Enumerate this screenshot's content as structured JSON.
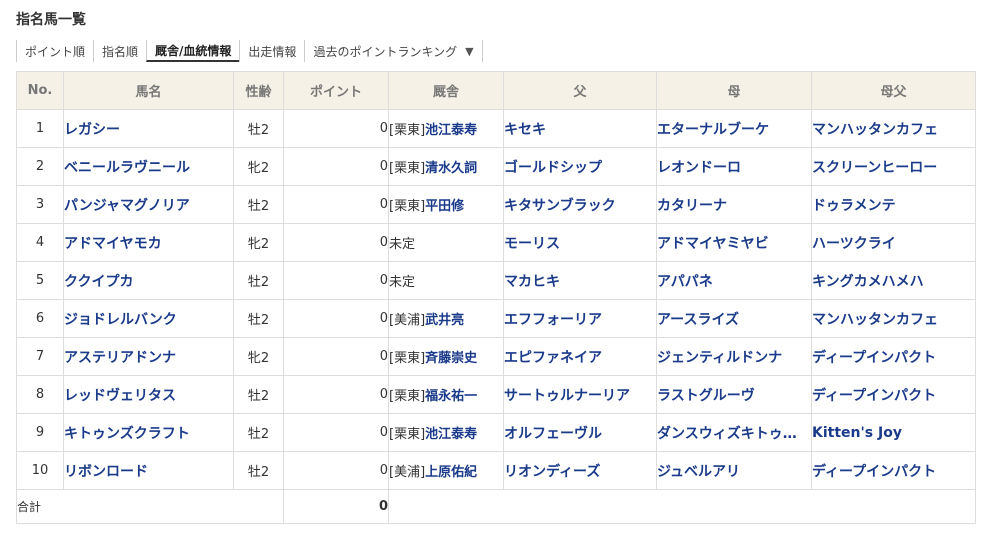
{
  "page": {
    "title": "指名馬一覧"
  },
  "tabs": [
    "ポイント順",
    "指名順",
    "厩舎/血統情報",
    "出走情報",
    "過去のポイントランキング"
  ],
  "active_tab": 2,
  "table": {
    "headers": [
      "No.",
      "馬名",
      "性齢",
      "ポイント",
      "厩舎",
      "父",
      "母",
      "母父"
    ],
    "rows": [
      {
        "no": "1",
        "name": "レガシー",
        "sex": "牡2",
        "points": "0",
        "region": "[栗東]",
        "trainer": "池江泰寿",
        "sire": "キセキ",
        "dam": "エターナルブーケ",
        "damsire": "マンハッタンカフェ"
      },
      {
        "no": "2",
        "name": "ベニールラヴニール",
        "sex": "牝2",
        "points": "0",
        "region": "[栗東]",
        "trainer": "清水久詞",
        "sire": "ゴールドシップ",
        "dam": "レオンドーロ",
        "damsire": "スクリーンヒーロー"
      },
      {
        "no": "3",
        "name": "パンジャマグノリア",
        "sex": "牡2",
        "points": "0",
        "region": "[栗東]",
        "trainer": "平田修",
        "sire": "キタサンブラック",
        "dam": "カタリーナ",
        "damsire": "ドゥラメンテ"
      },
      {
        "no": "4",
        "name": "アドマイヤモカ",
        "sex": "牝2",
        "points": "0",
        "region": "",
        "trainer": "未定",
        "sire": "モーリス",
        "dam": "アドマイヤミヤビ",
        "damsire": "ハーツクライ"
      },
      {
        "no": "5",
        "name": "ククイプカ",
        "sex": "牡2",
        "points": "0",
        "region": "",
        "trainer": "未定",
        "sire": "マカヒキ",
        "dam": "アパパネ",
        "damsire": "キングカメハメハ"
      },
      {
        "no": "6",
        "name": "ジョドレルバンク",
        "sex": "牡2",
        "points": "0",
        "region": "[美浦]",
        "trainer": "武井亮",
        "sire": "エフフォーリア",
        "dam": "アースライズ",
        "damsire": "マンハッタンカフェ"
      },
      {
        "no": "7",
        "name": "アステリアドンナ",
        "sex": "牝2",
        "points": "0",
        "region": "[栗東]",
        "trainer": "斉藤崇史",
        "sire": "エピファネイア",
        "dam": "ジェンティルドンナ",
        "damsire": "ディープインパクト"
      },
      {
        "no": "8",
        "name": "レッドヴェリタス",
        "sex": "牡2",
        "points": "0",
        "region": "[栗東]",
        "trainer": "福永祐一",
        "sire": "サートゥルナーリア",
        "dam": "ラストグルーヴ",
        "damsire": "ディープインパクト"
      },
      {
        "no": "9",
        "name": "キトゥンズクラフト",
        "sex": "牡2",
        "points": "0",
        "region": "[栗東]",
        "trainer": "池江泰寿",
        "sire": "オルフェーヴル",
        "dam": "ダンスウィズキトゥ…",
        "damsire": "Kitten's Joy"
      },
      {
        "no": "10",
        "name": "リボンロード",
        "sex": "牡2",
        "points": "0",
        "region": "[美浦]",
        "trainer": "上原佑紀",
        "sire": "リオンディーズ",
        "dam": "ジュベルアリ",
        "damsire": "ディープインパクト"
      }
    ],
    "total_label": "合計",
    "total_points": "0"
  }
}
